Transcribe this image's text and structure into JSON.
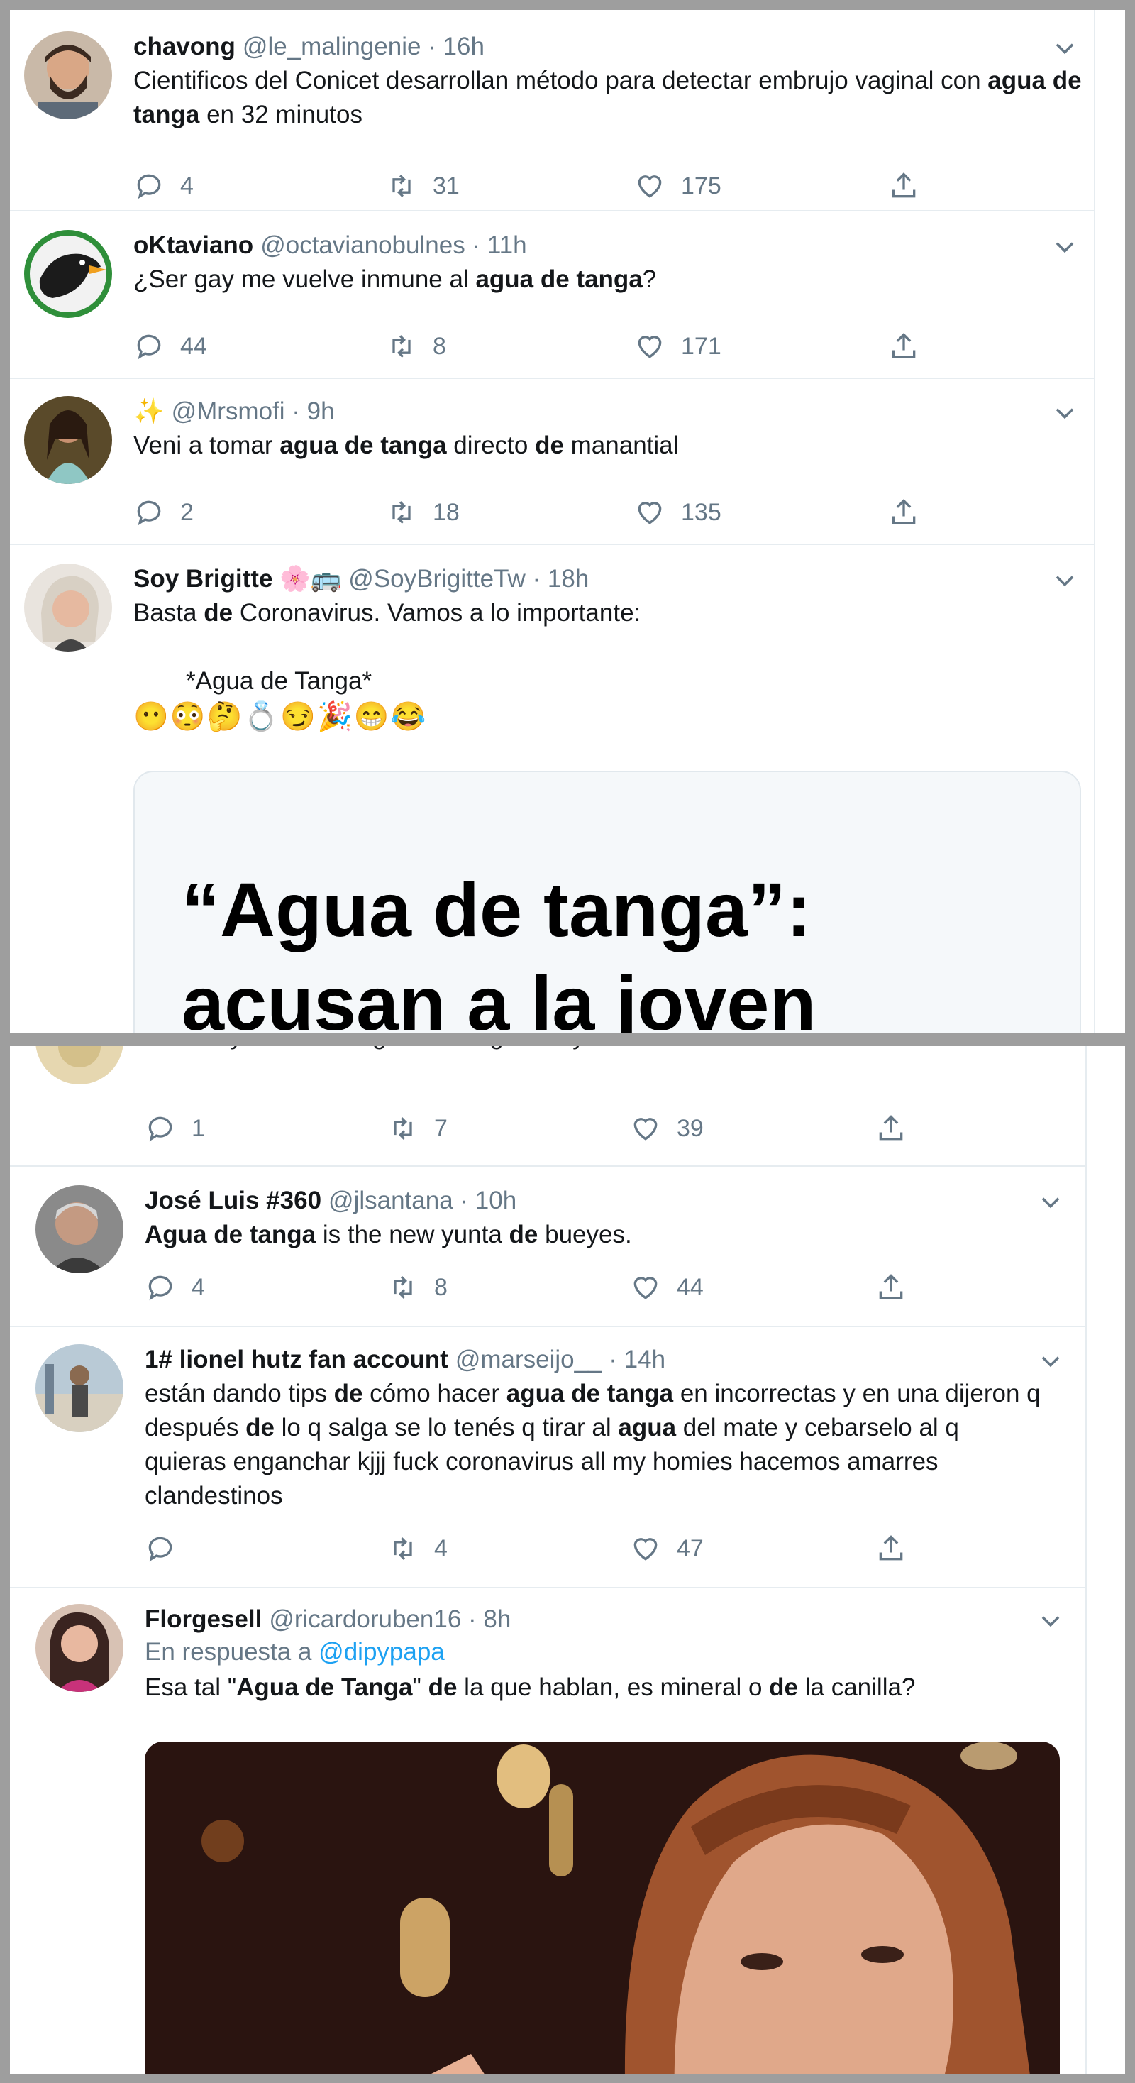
{
  "tweets_top": [
    {
      "name": "chavong",
      "handle": "@le_malingenie",
      "time": "16h",
      "text_html": "Cientificos del Conicet desarrollan método para detectar embrujo vaginal con <b>agua de tanga</b> en 32 minutos",
      "replies": "4",
      "retweets": "31",
      "likes": "175"
    },
    {
      "name": "oKtaviano",
      "handle": "@octavianobulnes",
      "time": "11h",
      "text_html": "¿Ser gay me vuelve inmune al <b>agua de tanga</b>?",
      "replies": "44",
      "retweets": "8",
      "likes": "171"
    },
    {
      "name": "✨",
      "handle": "@Mrsmofi",
      "time": "9h",
      "text_html": "Veni a tomar <b>agua de tanga</b> directo <b>de</b> manantial",
      "replies": "2",
      "retweets": "18",
      "likes": "135"
    },
    {
      "name": "Soy Brigitte 🌸🚌",
      "handle": "@SoyBrigitteTw",
      "time": "18h",
      "text_html": "Basta <b>de</b> Coronavirus. Vamos a lo importante:",
      "quote": "*Agua de Tanga*",
      "emojis": "😶😳🤔💍😏🎉😁😂",
      "card_headline": "“Agua de tanga”: acusan a la joven esposa del"
    }
  ],
  "partial_tweet_text": "Un litro y medio de agua de tanga en ayunas te detiene el coronavirus forever",
  "partial_tweet_stats": {
    "replies": "1",
    "retweets": "7",
    "likes": "39"
  },
  "tweets_bottom": [
    {
      "name": "José Luis #360",
      "handle": "@jlsantana",
      "time": "10h",
      "text_html": "<b>Agua de tanga</b> is the new yunta <b>de</b> bueyes.",
      "replies": "4",
      "retweets": "8",
      "likes": "44"
    },
    {
      "name": "1# lionel hutz fan account",
      "handle": "@marseijo__",
      "time": "14h",
      "text_html": "están dando tips <b>de</b> cómo hacer <b>agua de tanga</b> en incorrectas y en una dijeron q después <b>de</b> lo q salga se lo tenés q tirar al <b>agua</b> del mate y cebarselo al q quieras enganchar kjjj fuck coronavirus all my homies hacemos amarres clandestinos",
      "replies": "",
      "retweets": "4",
      "likes": "47"
    },
    {
      "name": "Florgesell",
      "handle": "@ricardoruben16",
      "time": "8h",
      "reply_prefix": "En respuesta a",
      "reply_mention": "@dipypapa",
      "text_html": "Esa tal \"<b>Agua de Tanga</b>\" <b>de</b> la que hablan, es mineral o <b>de</b> la canilla?"
    }
  ],
  "colors": {
    "accent": "#1da1f2",
    "muted": "#657786",
    "divider": "#e6ecf0"
  },
  "icons": [
    "reply-icon",
    "retweet-icon",
    "like-icon",
    "share-icon",
    "chevron-down-icon"
  ]
}
